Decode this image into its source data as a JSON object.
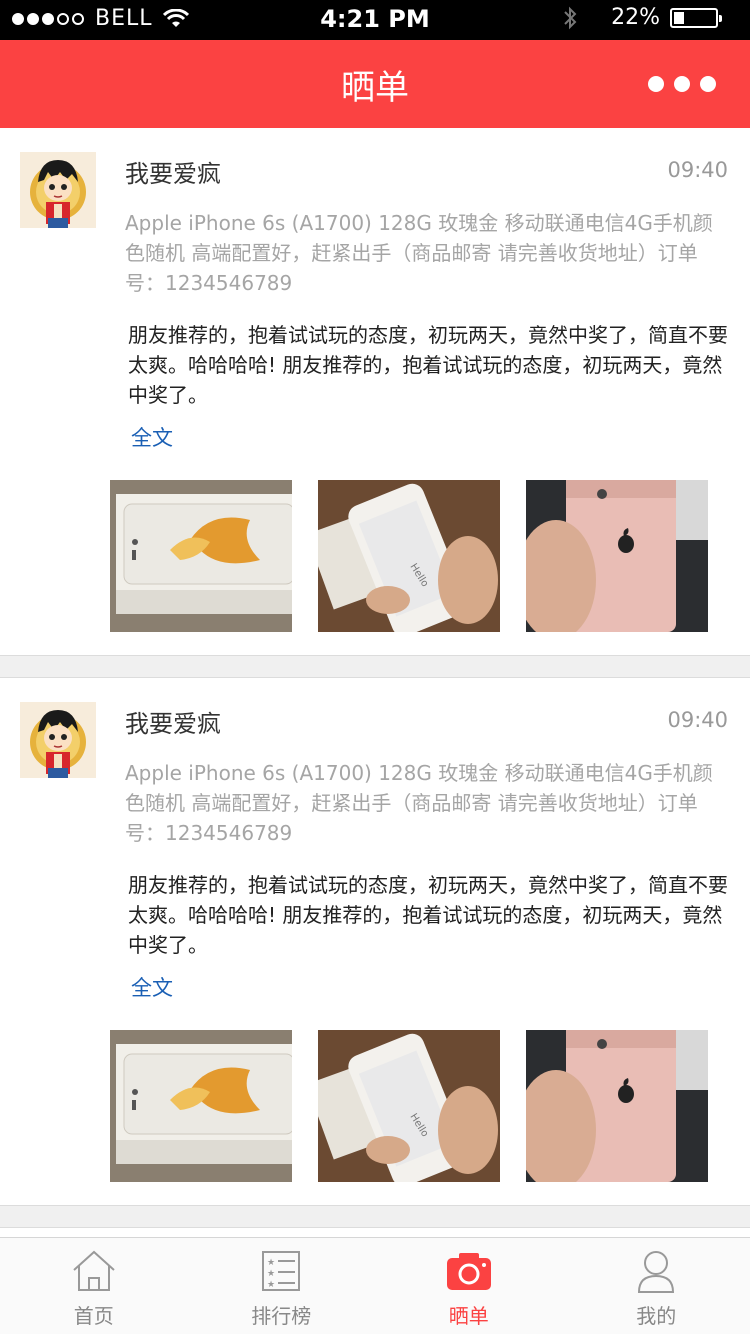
{
  "status_bar": {
    "carrier": "BELL",
    "time": "4:21 PM",
    "battery": "22%",
    "battery_level": 0.22
  },
  "header": {
    "title": "晒单"
  },
  "posts": [
    {
      "username": "我要爱疯",
      "time": "09:40",
      "product": "Apple iPhone 6s (A1700) 128G 玫瑰金 移动联通电信4G手机颜色随机 高端配置好，赶紧出手（商品邮寄 请完善收货地址）订单号：1234546789",
      "comment": "朋友推荐的，抱着试试玩的态度，初玩两天，竟然中奖了，简直不要太爽。哈哈哈哈! 朋友推荐的，抱着试试玩的态度，初玩两天，竟然中奖了。",
      "fulltext_label": "全文"
    },
    {
      "username": "我要爱疯",
      "time": "09:40",
      "product": "Apple iPhone 6s (A1700) 128G 玫瑰金 移动联通电信4G手机颜色随机 高端配置好，赶紧出手（商品邮寄 请完善收货地址）订单号：1234546789",
      "comment": "朋友推荐的，抱着试试玩的态度，初玩两天，竟然中奖了，简直不要太爽。哈哈哈哈! 朋友推荐的，抱着试试玩的态度，初玩两天，竟然中奖了。",
      "fulltext_label": "全文"
    }
  ],
  "tabs": [
    {
      "label": "首页",
      "icon": "home-icon",
      "active": false
    },
    {
      "label": "排行榜",
      "icon": "ranking-list-icon",
      "active": false
    },
    {
      "label": "晒单",
      "icon": "camera-icon",
      "active": true
    },
    {
      "label": "我的",
      "icon": "user-icon",
      "active": false
    }
  ],
  "colors": {
    "accent": "#fb4242",
    "link": "#1a5fb4",
    "muted_text": "#a5a5a5"
  }
}
